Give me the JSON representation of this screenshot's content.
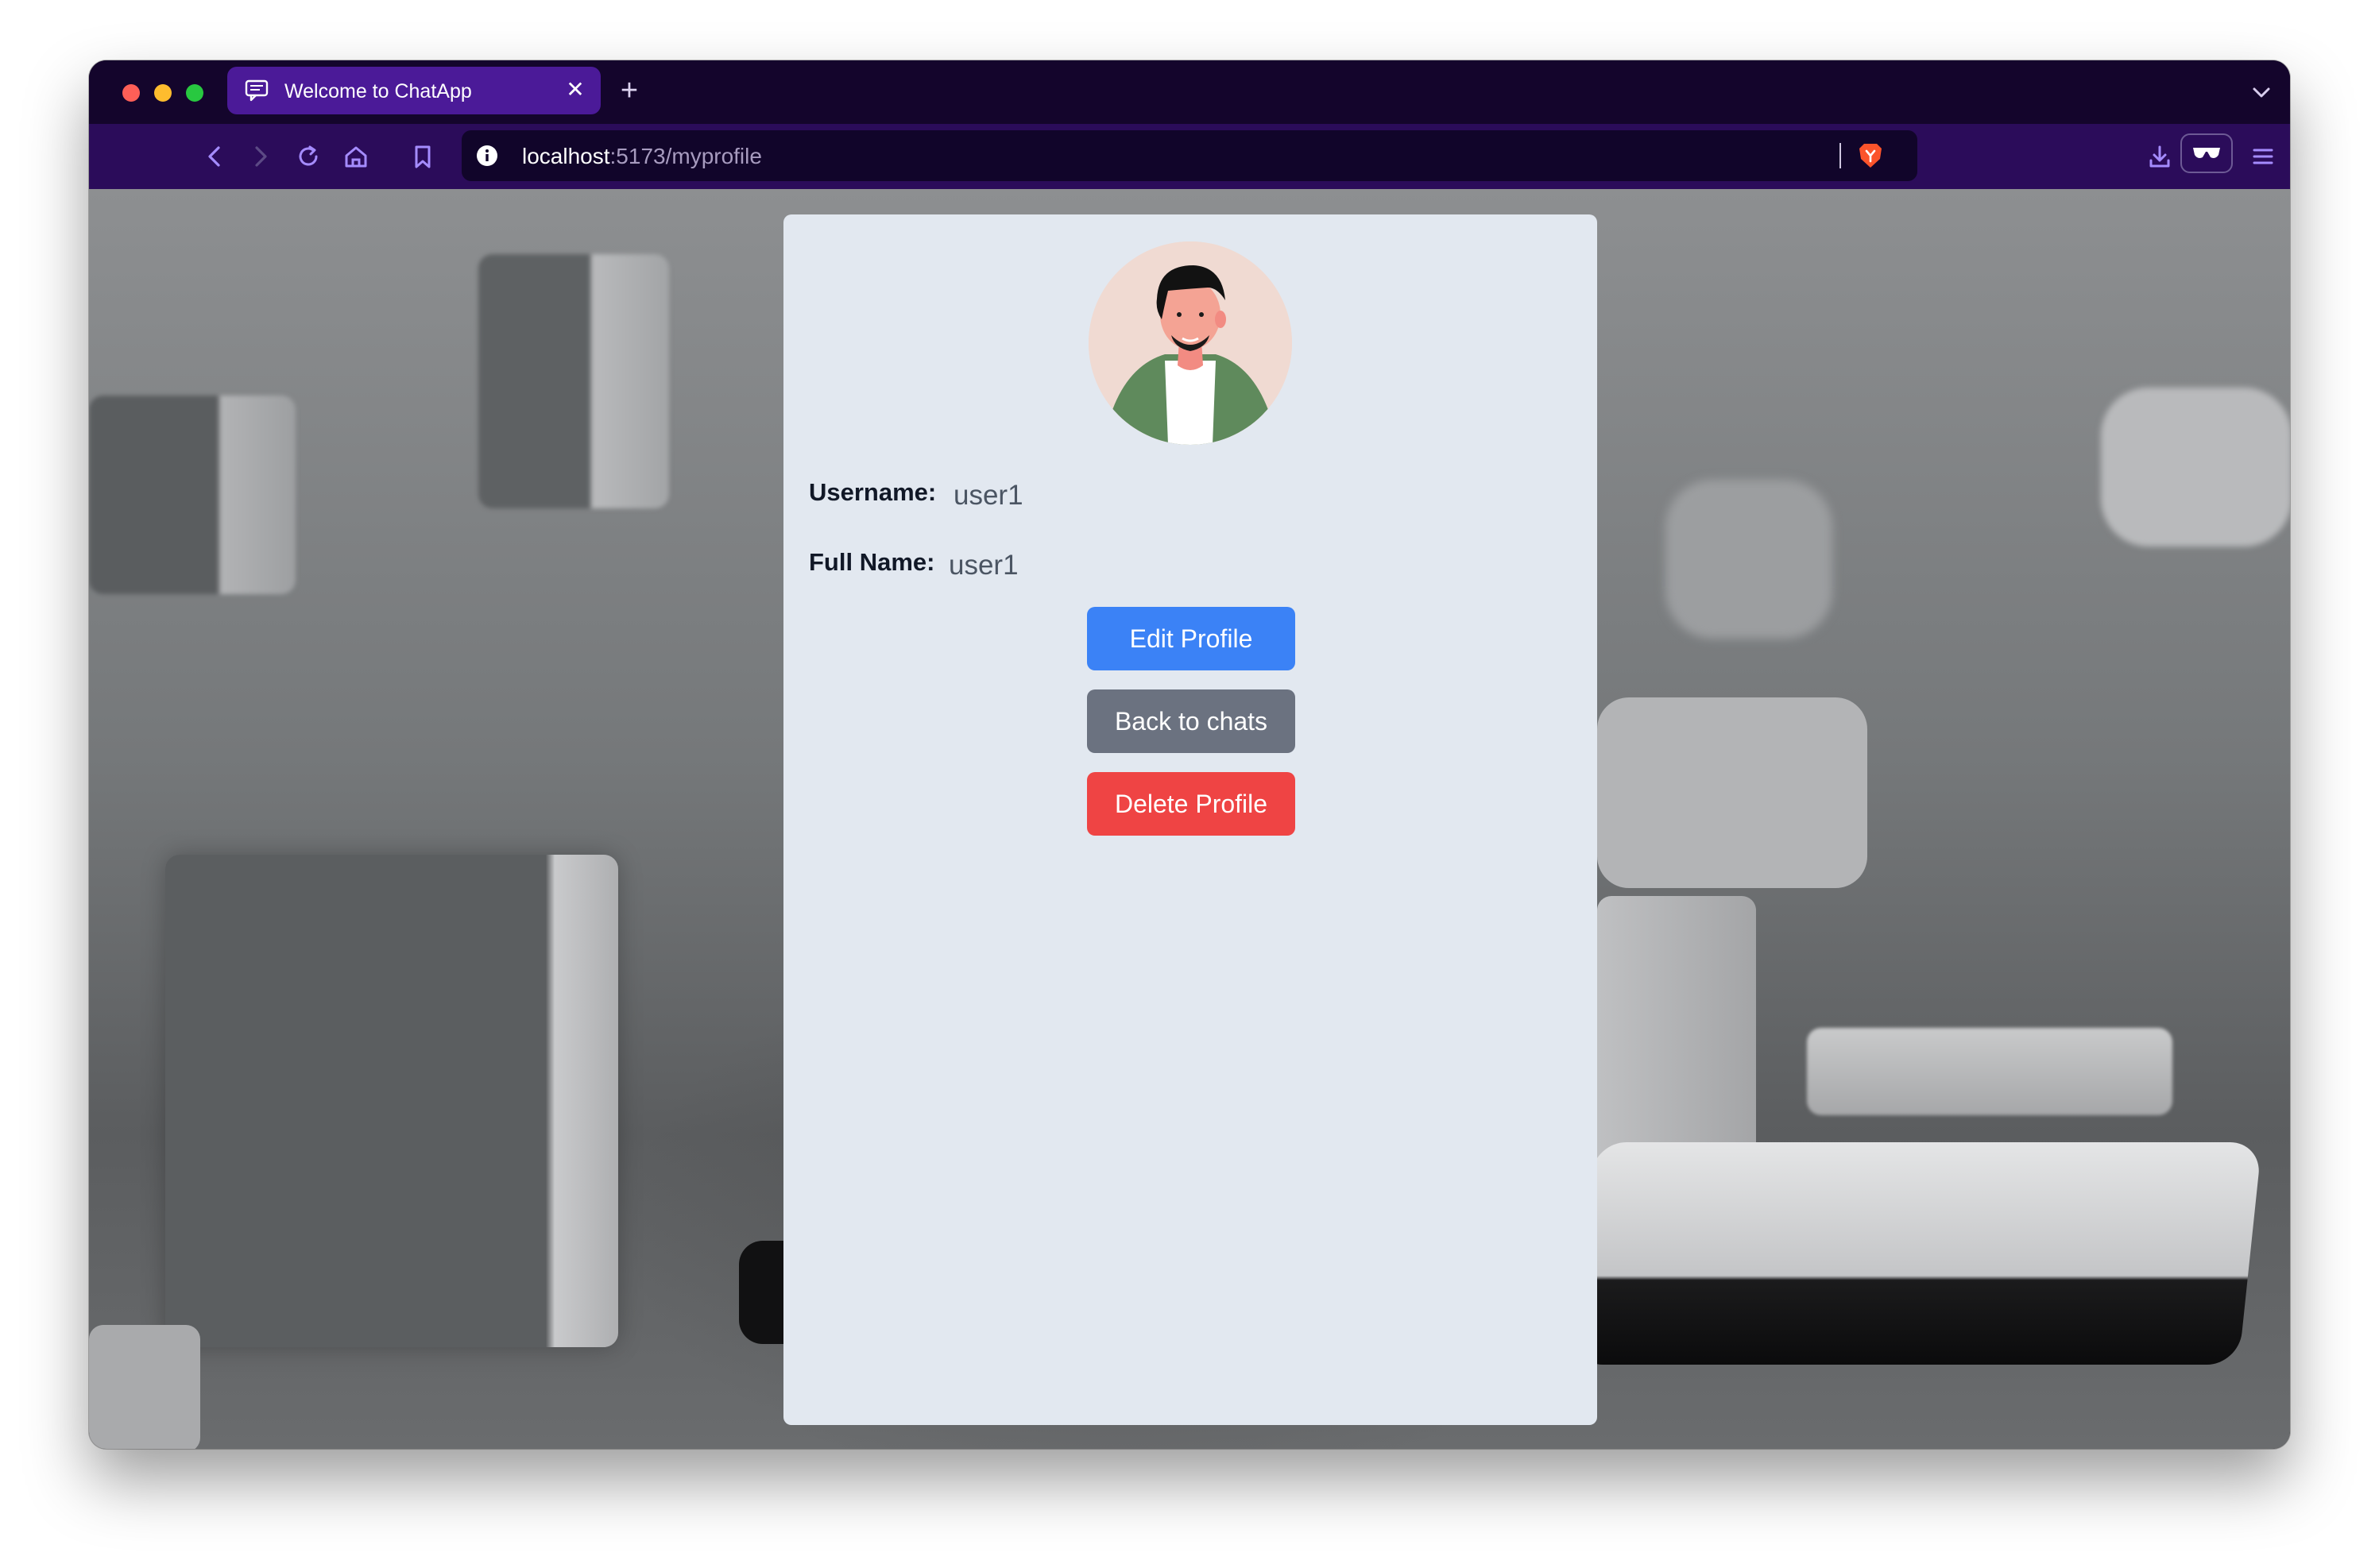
{
  "browser": {
    "tab": {
      "title": "Welcome to ChatApp"
    },
    "url": {
      "host": "localhost",
      "rest": ":5173/myprofile"
    },
    "icons": {
      "window_controls": [
        "close",
        "minimize",
        "maximize"
      ],
      "tab": [
        "chat-favicon-icon",
        "close-icon",
        "plus-icon",
        "chevron-down-icon"
      ],
      "toolbar": [
        "back-icon",
        "forward-icon",
        "reload-icon",
        "home-icon",
        "bookmark-icon",
        "info-icon",
        "brave-shield-icon",
        "download-icon",
        "reader-glasses-icon",
        "menu-icon"
      ]
    },
    "colors": {
      "tabstrip": "#14052c",
      "active_tab": "#4b1a98",
      "toolbar": "#2b0c5a",
      "urlbar": "#11052a"
    }
  },
  "profile": {
    "username_label": "Username:",
    "username_value": "user1",
    "fullname_label": "Full Name:",
    "fullname_value": "user1",
    "avatar_icon": "avatar-illustration"
  },
  "actions": {
    "edit_label": "Edit Profile",
    "back_label": "Back to chats",
    "delete_label": "Delete Profile",
    "colors": {
      "edit": "#3b82f6",
      "back": "#6b7280",
      "delete": "#ef4444"
    }
  }
}
